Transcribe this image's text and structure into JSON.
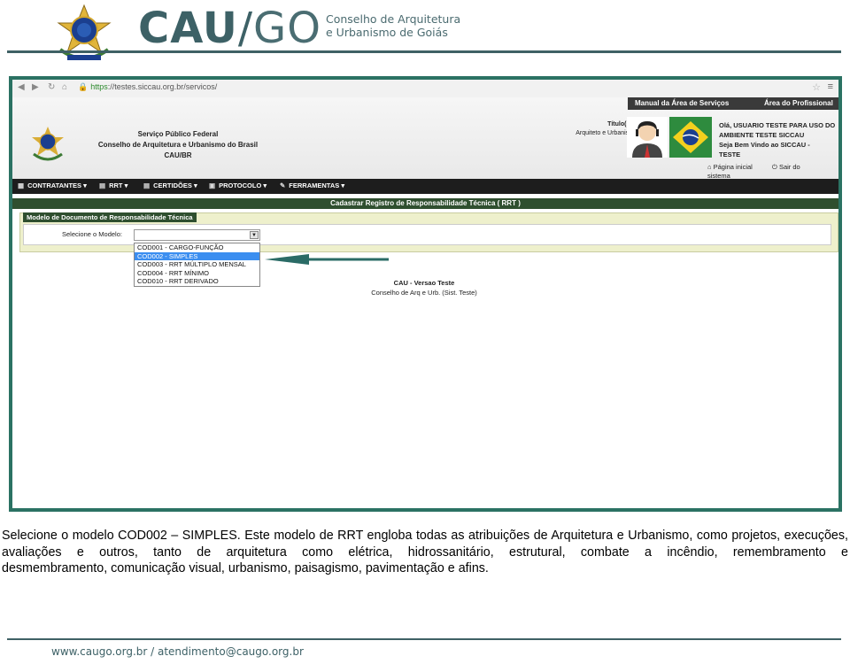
{
  "header": {
    "logo_text_cau": "CAU",
    "logo_text_slash": "/",
    "logo_text_go": "GO",
    "council_line1": "Conselho de Arquitetura",
    "council_line2": "e Urbanismo de Goiás"
  },
  "browser": {
    "url_scheme": "https",
    "url_rest": "://testes.siccau.org.br/servicos/"
  },
  "site": {
    "top_links": [
      "Manual da Área de Serviços",
      "Área do Profissional"
    ],
    "title_lines": [
      "Serviço Público Federal",
      "Conselho de Arquitetura e Urbanismo do Brasil",
      "CAU/BR"
    ],
    "titulo_label": "Título(s):",
    "titulo_value": "Arquiteto e Urbanista",
    "greeting_lines": [
      "Olá, USUARIO TESTE PARA USO DO",
      "AMBIENTE TESTE SICCAU",
      "Seja Bem Vindo ao SICCAU -",
      "TESTE"
    ],
    "actions": [
      "Página inicial",
      "Sair do sistema"
    ]
  },
  "nav": {
    "items": [
      "CONTRATANTES",
      "RRT",
      "CERTIDÕES",
      "PROTOCOLO",
      "FERRAMENTAS"
    ]
  },
  "page": {
    "banner": "Cadastrar Registro de Responsabilidade Técnica ( RRT )",
    "panel_title": "Modelo de Documento de Responsabilidade Técnica",
    "select_label": "Selecione o Modelo:",
    "options": [
      "COD001 - CARGO-FUNÇÃO",
      "COD002 - SIMPLES",
      "COD003 - RRT MÚLTIPLO MENSAL",
      "COD004 - RRT MÍNIMO",
      "COD010 - RRT DERIVADO"
    ],
    "highlighted_option": "COD002 - SIMPLES",
    "footer_line1": "CAU - Versao Teste",
    "footer_line2": "Conselho de Arq e Urb. (Sist. Teste)"
  },
  "caption": {
    "paragraph_part1": "Selecione o modelo COD002 – SIMPLES. Este modelo de RRT engloba todas as atribuições de Arquitetura e Urbanismo, como projetos, execuções, avaliações e outros, tanto de arquitetura como elétrica, hidrossanitário, estrutural, combate a incêndio, remembramento e",
    "paragraph_part2": "desmembramento, comunicação visual, urbanismo, paisagismo, pavimentação e afins."
  },
  "footer": {
    "text": "www.caugo.org.br / atendimento@caugo.org.br"
  },
  "colors": {
    "brand_dark": "#3d6166",
    "frame_green": "#2b7263",
    "banner_green": "#2f4f2f",
    "highlight_blue": "#3b8ef0",
    "arrow_teal": "#2a6b66"
  }
}
